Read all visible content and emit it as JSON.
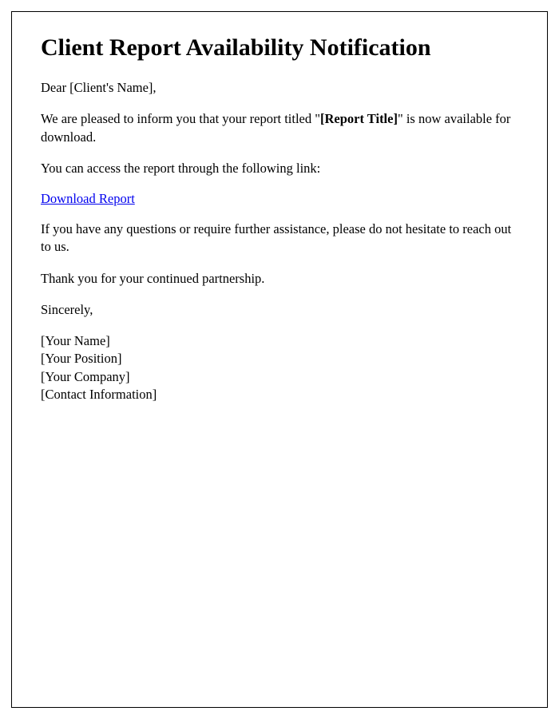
{
  "title": "Client Report Availability Notification",
  "salutation": "Dear [Client's Name],",
  "intro_prefix": "We are pleased to inform you that your report titled \"",
  "report_title": "[Report Title]",
  "intro_suffix": "\" is now available for download.",
  "access_line": "You can access the report through the following link:",
  "download_link_text": "Download Report",
  "assistance_line": "If you have any questions or require further assistance, please do not hesitate to reach out to us.",
  "thanks_line": "Thank you for your continued partnership.",
  "closing": "Sincerely,",
  "signature": {
    "name": "[Your Name]",
    "position": "[Your Position]",
    "company": "[Your Company]",
    "contact": "[Contact Information]"
  }
}
